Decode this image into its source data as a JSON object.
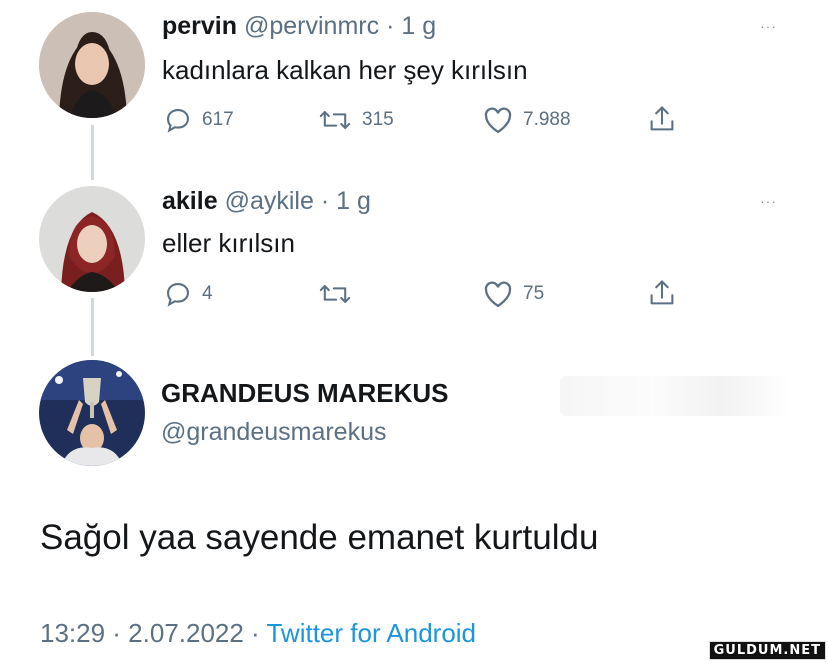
{
  "tweet1": {
    "name": "pervin",
    "handle": "@pervinmrc",
    "sep": "·",
    "time": "1 g",
    "text": "kadınlara kalkan her şey kırılsın",
    "replies": "617",
    "retweets": "315",
    "likes": "7.988",
    "more": "···"
  },
  "tweet2": {
    "name": "akile",
    "handle": "@aykile",
    "sep": "·",
    "time": "1 g",
    "text": "eller kırılsın",
    "replies": "4",
    "retweets": "",
    "likes": "75",
    "more": "···"
  },
  "main_tweet": {
    "name": "GRANDEUS MAREKUS",
    "handle": "@grandeusmarekus",
    "text": "Sağol yaa sayende emanet kurtuldu",
    "timestamp": "13:29 · 2.07.2022 ·",
    "source": "Twitter for Android"
  },
  "watermark": "GULDUM.NET",
  "colors": {
    "text": "#14171a",
    "muted": "#5b7083",
    "link": "#1b95e0",
    "thread_line": "#cfd9de"
  },
  "icons": [
    "reply-icon",
    "retweet-icon",
    "like-icon",
    "share-icon",
    "more-icon"
  ]
}
